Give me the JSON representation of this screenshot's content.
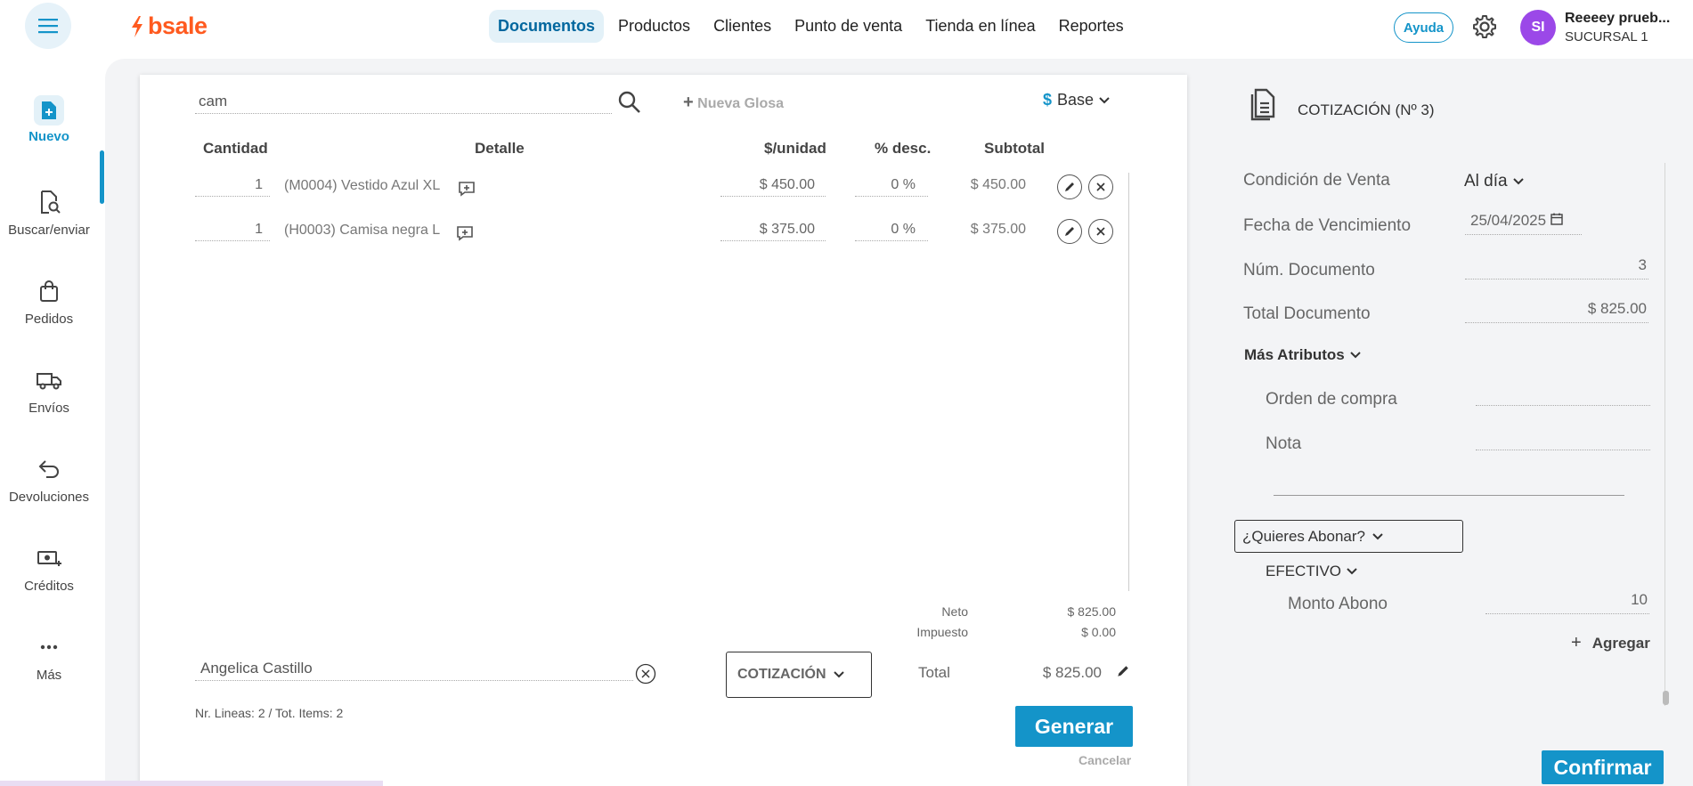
{
  "header": {
    "brand": "bsale",
    "nav": [
      "Documentos",
      "Productos",
      "Clientes",
      "Punto de venta",
      "Tienda en línea",
      "Reportes"
    ],
    "help_label": "Ayuda",
    "avatar_initials": "SI",
    "user_name": "Reeeey prueb...",
    "branch": "SUCURSAL 1"
  },
  "sidebar": {
    "items": [
      {
        "label": "Nuevo",
        "icon": "new-document-icon"
      },
      {
        "label": "Buscar/enviar",
        "icon": "search-document-icon"
      },
      {
        "label": "Pedidos",
        "icon": "bag-icon"
      },
      {
        "label": "Envíos",
        "icon": "truck-icon"
      },
      {
        "label": "Devoluciones",
        "icon": "return-icon"
      },
      {
        "label": "Créditos",
        "icon": "credit-icon"
      },
      {
        "label": "Más",
        "icon": "more-icon"
      }
    ]
  },
  "document": {
    "search_value": "cam",
    "new_gloss": "Nueva Glosa",
    "currency_symbol": "$",
    "price_list": "Base",
    "columns": {
      "qty": "Cantidad",
      "detail": "Detalle",
      "unit": "$/unidad",
      "disc": "% desc.",
      "subtotal": "Subtotal"
    },
    "lines": [
      {
        "qty": "1",
        "detail": "(M0004) Vestido Azul XL",
        "unit": "$ 450.00",
        "disc": "0 %",
        "subtotal": "$ 450.00"
      },
      {
        "qty": "1",
        "detail": "(H0003) Camisa negra L",
        "unit": "$ 375.00",
        "disc": "0 %",
        "subtotal": "$ 375.00"
      }
    ],
    "neto_label": "Neto",
    "neto_value": "$ 825.00",
    "tax_label": "Impuesto",
    "tax_value": "$ 0.00",
    "client": "Angelica Castillo",
    "doc_type": "COTIZACIÓN",
    "total_label": "Total",
    "total_value": "$ 825.00",
    "counts": "Nr. Lineas: 2 / Tot. Items: 2",
    "generate_label": "Generar",
    "cancel_label": "Cancelar"
  },
  "panel": {
    "title": "COTIZACIÓN (Nº 3)",
    "sale_condition_label": "Condición de Venta",
    "sale_condition_value": "Al día",
    "due_date_label": "Fecha de Vencimiento",
    "due_date_value": "25/04/2025",
    "doc_number_label": "Núm. Documento",
    "doc_number_value": "3",
    "doc_total_label": "Total Documento",
    "doc_total_value": "$ 825.00",
    "more_attrs_label": "Más Atributos",
    "po_label": "Orden de compra",
    "po_value": "",
    "note_label": "Nota",
    "note_value": "",
    "pay_question": "¿Quieres Abonar?",
    "payment_method": "EFECTIVO",
    "payment_amount_label": "Monto Abono",
    "payment_amount_value": "10",
    "add_label": "Agregar",
    "confirm_label": "Confirmar"
  },
  "colors": {
    "accent": "#1494c9",
    "brand": "#ff5a1f",
    "avatar": "#9b48e8"
  }
}
